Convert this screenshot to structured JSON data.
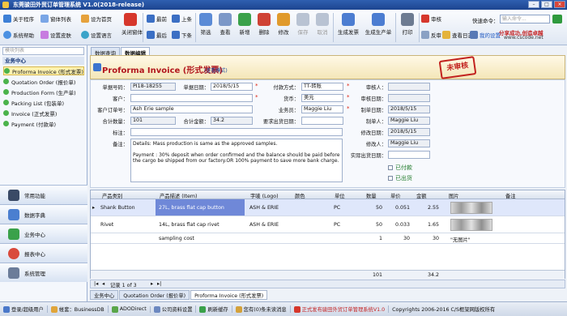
{
  "window": {
    "title": "东莞骏田外贸订单管理系统 V1.0(2018-release)"
  },
  "toolbar": {
    "about": "关于程序",
    "window_list": "窗体列表",
    "set_home": "设为首页",
    "system_help": "系统帮助",
    "set_skin": "设置皮肤",
    "set_language": "设置语言",
    "close_window": "关闭窗体",
    "first": "最前",
    "prev": "上条",
    "last": "最后",
    "next": "下条",
    "filter": "筛选",
    "view": "查看",
    "add": "新增",
    "delete": "删除",
    "edit": "修改",
    "save": "保存",
    "cancel": "取消",
    "gen_invoice": "生成发票",
    "gen_production": "生成生产单",
    "print": "打印",
    "audit": "审核",
    "unaudit": "反审",
    "view_log": "查看日志",
    "my_settings": "我的设置",
    "shortcut_label": "快速命令：",
    "shortcut_placeholder": "输入命令...",
    "brand_line1": "分享成功,创造卓越",
    "brand_line2": "www.cscode.net"
  },
  "sidebar": {
    "search_placeholder": "模块列表",
    "group": "业务中心",
    "items": [
      {
        "label": "Proforma Invoice (形式发票)"
      },
      {
        "label": "Quotation Order (报价单)"
      },
      {
        "label": "Production Form (生产单)"
      },
      {
        "label": "Packing List (包装单)"
      },
      {
        "label": "Invoice (正式发票)"
      },
      {
        "label": "Payment (付款单)"
      }
    ],
    "nav": [
      {
        "label": "常用功能"
      },
      {
        "label": "数据字典"
      },
      {
        "label": "业务中心"
      },
      {
        "label": "报表中心"
      },
      {
        "label": "系统管理"
      }
    ]
  },
  "tabs": {
    "query": "数据查询",
    "edit": "数据编辑"
  },
  "doc": {
    "title": "Proforma Invoice (形式发票)",
    "mode": "(查看模式)",
    "stamp": "未审核"
  },
  "form": {
    "no_label": "单据号码：",
    "no_value": "PI18-18255",
    "date_label": "单据日期：",
    "date_value": "2018/5/15",
    "paymethod_label": "付款方式：",
    "paymethod_value": "TT-转账",
    "auditor_label": "审核人：",
    "auditor_value": "",
    "customer_label": "客户：",
    "customer_value": "",
    "currency_label": "货币：",
    "currency_value": "美元",
    "audit_date_label": "审核日期：",
    "audit_date_value": "",
    "custorder_label": "客户订单号：",
    "custorder_value": "Ash Erie sample",
    "salesman_label": "业务员：",
    "salesman_value": "Maggie Liu",
    "created_date_label": "制单日期：",
    "created_date_value": "2018/5/15",
    "total_qty_label": "合计数量：",
    "total_qty_value": "101",
    "total_amt_label": "合计金额：",
    "total_amt_value": "34.2",
    "ship_date_label": "要求出货日期：",
    "ship_date_value": "",
    "creator_label": "制单人：",
    "creator_value": "Maggie Liu",
    "mark_label": "标注：",
    "mark_value": "",
    "modified_date_label": "修改日期：",
    "modified_date_value": "2018/5/15",
    "remark_label": "备注：",
    "remark_value": "Details: Mass production is same as the approved samples.\n\nPayment : 30% deposit when order confirmed and the balance should be paid before the cargo be shipped from our factory.OR 100% payment to save more bank charge.",
    "modifier_label": "修改人：",
    "modifier_value": "Maggie Liu",
    "actual_ship_label": "实际出货日期：",
    "actual_ship_value": "",
    "paid_label": "已付款",
    "shipped_label": "已出货"
  },
  "grid": {
    "headers": [
      "产品类别",
      "产品描述 (Item)",
      "字唛 (Logo)",
      "颜色",
      "单位",
      "数量",
      "单价",
      "金额",
      "图片",
      "备注"
    ],
    "rows": [
      {
        "category": "Shank Button",
        "desc": "27L, brass flat cap button",
        "logo": "ASH & ERIE",
        "color": "",
        "unit": "PC",
        "qty": "50",
        "price": "0.051",
        "amount": "2.55",
        "image": ""
      },
      {
        "category": "Rivet",
        "desc": "14L, brass flat cap rivet",
        "logo": "ASH & ERIE",
        "color": "",
        "unit": "PC",
        "qty": "50",
        "price": "0.033",
        "amount": "1.65",
        "image": ""
      },
      {
        "category": "",
        "desc": "sampling cost",
        "logo": "",
        "color": "",
        "unit": "",
        "qty": "1",
        "price": "30",
        "amount": "30",
        "image": "\"无图片\""
      }
    ],
    "sum_qty": "101",
    "sum_amount": "34.2"
  },
  "nav": {
    "record": "记录 1 of 3"
  },
  "bottomtabs": [
    "业务中心",
    "Quotation Order (报价单)",
    "Proforma Invoice (形式发票)"
  ],
  "status": {
    "login": "登录/超级用户",
    "account": "帐套：BusinessDB",
    "ado": "ADODirect",
    "company": "公司资料设置",
    "refresh": "刷新缓存",
    "messages": "您有(0)条未读消息",
    "release": "正式发布骏田外贸订单管理系统V1.0",
    "copyright": "Copyrights 2006-2016 C/S框架网版权所有"
  },
  "colors": {
    "accent": "#b2161d",
    "titlebar": "#1d4590",
    "selection": "#6f88d8"
  }
}
